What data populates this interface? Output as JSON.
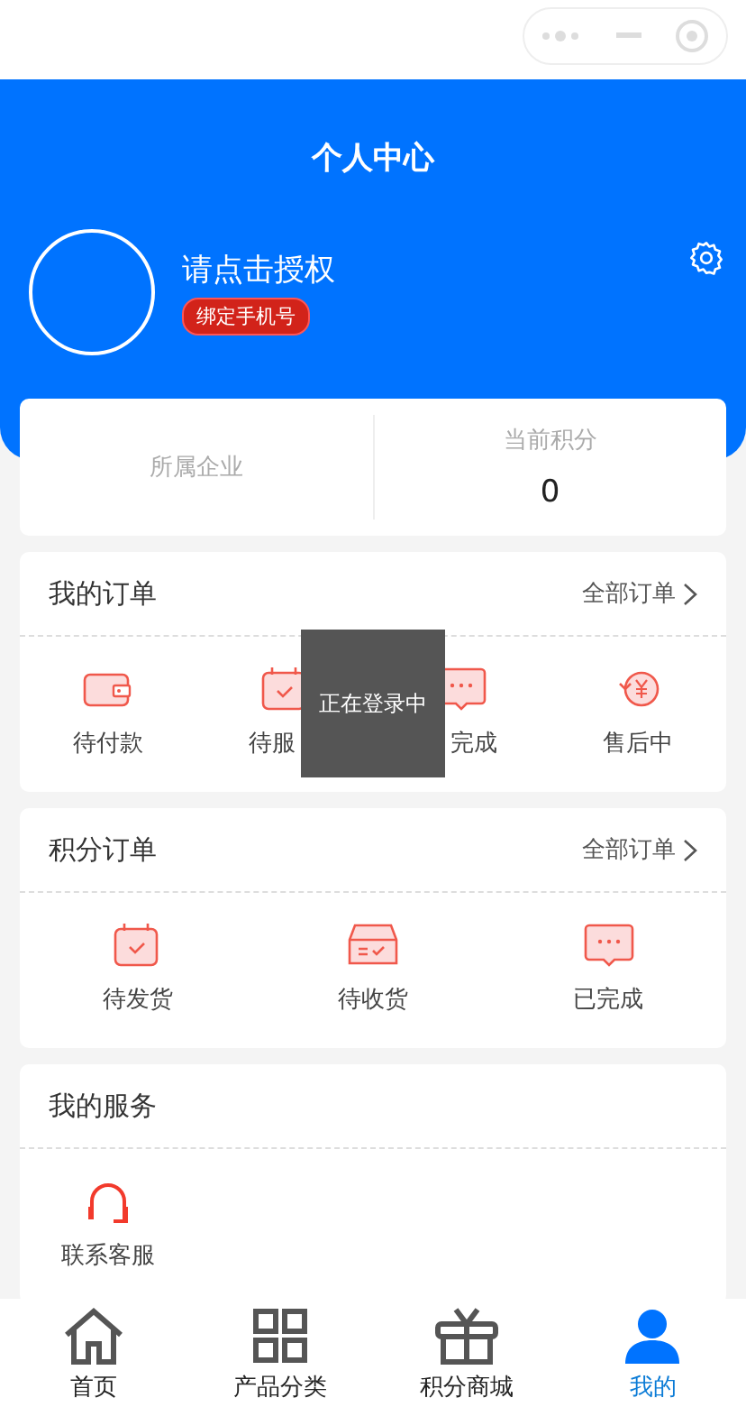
{
  "header": {
    "title": "个人中心"
  },
  "profile": {
    "name": "请点击授权",
    "bind_badge": "绑定手机号"
  },
  "stats": [
    {
      "label": "所属企业"
    },
    {
      "label": "当前积分",
      "value": "0"
    }
  ],
  "my_orders": {
    "title": "我的订单",
    "link": "全部订单",
    "items": [
      {
        "label": "待付款",
        "kind": "wallet"
      },
      {
        "label": "待服",
        "kind": "calendar",
        "clipped_end": true
      },
      {
        "label": "完成",
        "kind": "chat",
        "clipped_start": true
      },
      {
        "label": "售后中",
        "kind": "refund"
      }
    ]
  },
  "points_orders": {
    "title": "积分订单",
    "link": "全部订单",
    "items": [
      {
        "label": "待发货",
        "kind": "calendar"
      },
      {
        "label": "待收货",
        "kind": "box"
      },
      {
        "label": "已完成",
        "kind": "chat"
      }
    ]
  },
  "services": {
    "title": "我的服务",
    "items": [
      {
        "label": "联系客服",
        "kind": "headset"
      }
    ]
  },
  "toast": "正在登录中",
  "tab_bar": [
    {
      "label": "首页",
      "kind": "home",
      "selected": false
    },
    {
      "label": "产品分类",
      "kind": "grid",
      "selected": false
    },
    {
      "label": "积分商城",
      "kind": "gift",
      "selected": false
    },
    {
      "label": "我的",
      "kind": "user",
      "selected": true
    }
  ]
}
